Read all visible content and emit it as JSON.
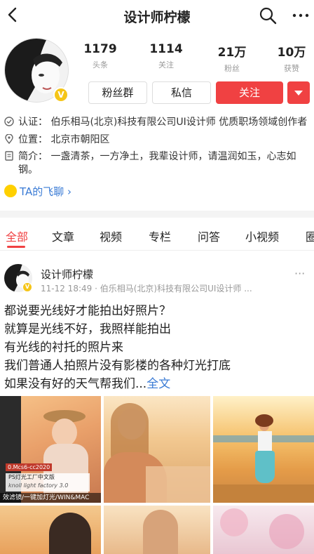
{
  "header": {
    "title": "设计师柠檬"
  },
  "profile": {
    "verified_badge": "V",
    "stats": [
      {
        "value": "1179",
        "label": "头条"
      },
      {
        "value": "1114",
        "label": "关注"
      },
      {
        "value": "21万",
        "label": "粉丝"
      },
      {
        "value": "10万",
        "label": "获赞"
      }
    ],
    "buttons": {
      "fans_group": "粉丝群",
      "message": "私信",
      "follow": "关注"
    },
    "certification": "认证：  伯乐相马(北京)科技有限公司UI设计师 优质职场领域创作者",
    "location": "位置：  北京市朝阳区",
    "intro_line1": "简介：  一盏清茶，一方净土，我辈设计师，请温润如玉，心志如",
    "intro_line2": "钢。",
    "feiliao": "TA的飞聊 ›"
  },
  "tabs": [
    "全部",
    "文章",
    "视频",
    "专栏",
    "问答",
    "小视频",
    "圈"
  ],
  "post": {
    "author": "设计师柠檬",
    "verified_badge": "V",
    "meta": "11-12 18:49 · 伯乐相马(北京)科技有限公司UI设计师 ...",
    "more": "···",
    "lines": [
      "都说要光线好才能拍出好照片？",
      "就算是光线不好，我照样能拍出",
      "有光线的衬托的照片来",
      "我们普通人拍照片没有影楼的各种灯光打底"
    ],
    "last_line": "如果没有好的天气帮我们...",
    "full_text": "全文",
    "image1_tag": "0.Mcs6-cc2020",
    "image1_title": "PS灯光工厂中文版",
    "image1_sub": "knoll light factory 3.0",
    "image1_bottom": "效滤镜/一键加灯光/WIN&MAC"
  },
  "colors": {
    "accent": "#f04142",
    "link": "#3a7bd5",
    "badge": "#f5c518"
  }
}
